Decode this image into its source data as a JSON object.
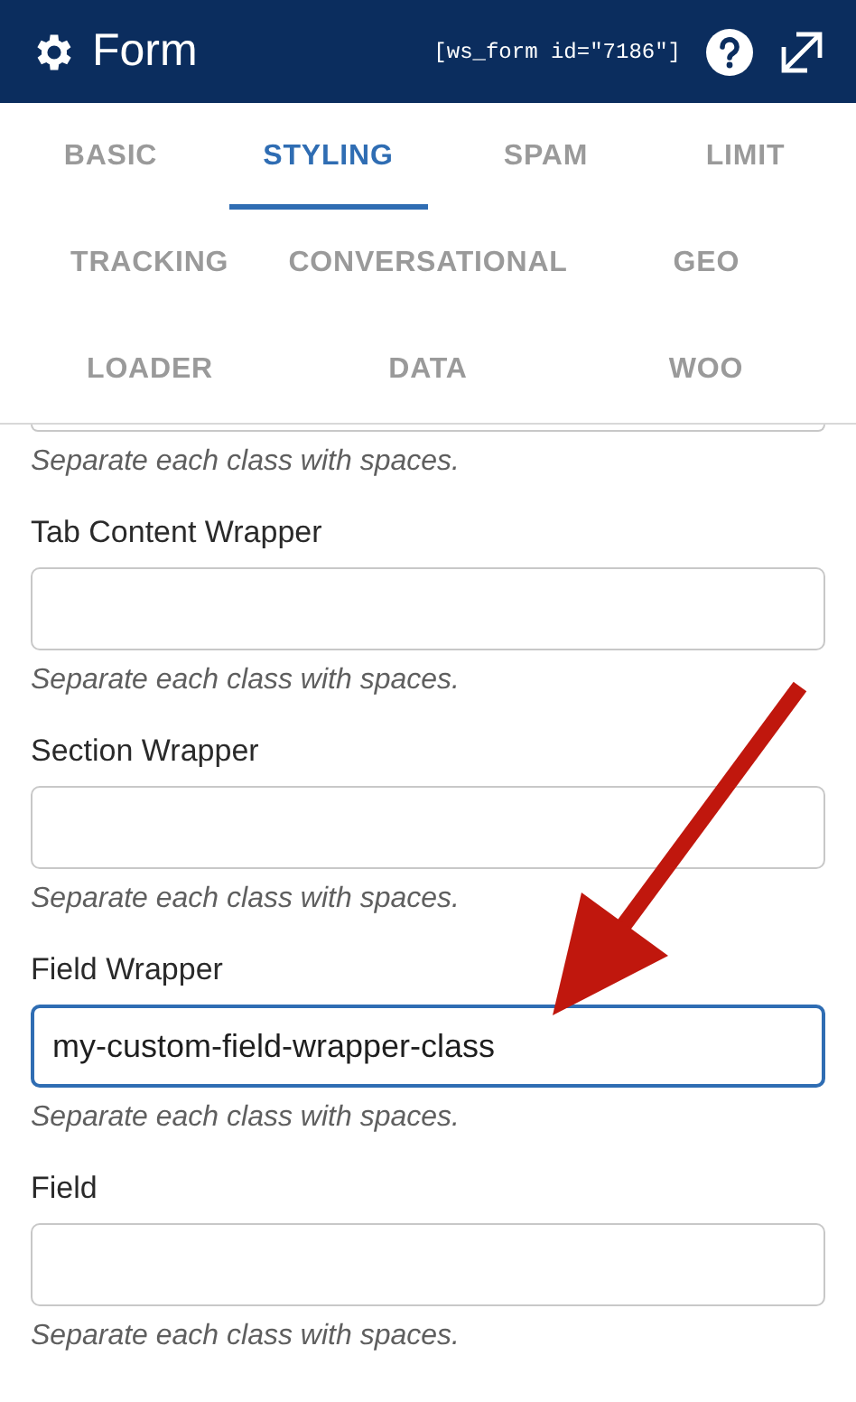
{
  "header": {
    "title": "Form",
    "shortcode": "[ws_form id=\"7186\"]"
  },
  "tab_rows": [
    [
      {
        "label": "BASIC",
        "selected": false
      },
      {
        "label": "STYLING",
        "selected": true
      },
      {
        "label": "SPAM",
        "selected": false
      },
      {
        "label": "LIMIT",
        "selected": false
      }
    ],
    [
      {
        "label": "TRACKING",
        "selected": false
      },
      {
        "label": "CONVERSATIONAL",
        "selected": false
      },
      {
        "label": "GEO",
        "selected": false
      }
    ],
    [
      {
        "label": "LOADER",
        "selected": false
      },
      {
        "label": "DATA",
        "selected": false
      },
      {
        "label": "WOO",
        "selected": false
      }
    ]
  ],
  "fields": [
    {
      "help": "Separate each class with spaces.",
      "focused": false
    },
    {
      "label": "Tab Content Wrapper",
      "help": "Separate each class with spaces.",
      "focused": false
    },
    {
      "label": "Section Wrapper",
      "help": "Separate each class with spaces.",
      "focused": false
    },
    {
      "label": "Field Wrapper",
      "value": "my-custom-field-wrapper-class",
      "help": "Separate each class with spaces.",
      "focused": true
    },
    {
      "label": "Field",
      "help": "Separate each class with spaces.",
      "focused": false
    }
  ]
}
